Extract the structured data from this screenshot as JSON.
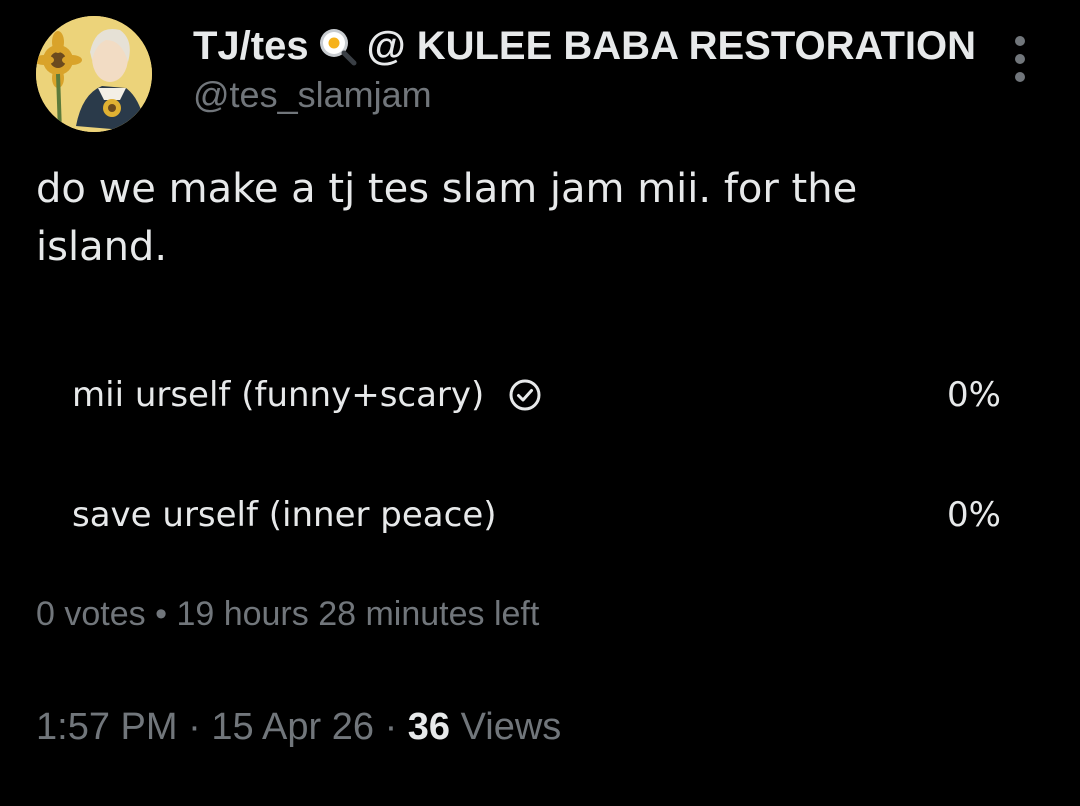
{
  "author": {
    "display_name_before_emoji": "TJ/tes",
    "display_name_emoji": "frying-pan-egg-emoji",
    "display_name_after_emoji": "@ KULEE BABA RESTORATION",
    "handle": "@tes_slamjam",
    "avatar": "profile-avatar-sunflower-illustration"
  },
  "more_menu_icon": "more-vertical-icon",
  "tweet": {
    "text": "do we make a tj tes slam jam mii. for the island."
  },
  "poll": {
    "options": [
      {
        "label": "mii urself (funny+scary)",
        "percent": "0%",
        "fraction": 0,
        "selected": true,
        "selected_icon": "check-circle-icon"
      },
      {
        "label": "save urself (inner peace)",
        "percent": "0%",
        "fraction": 0,
        "selected": false
      }
    ],
    "votes": "0 votes",
    "separator": "•",
    "time_left": "19 hours 28 minutes left"
  },
  "meta": {
    "time": "1:57 PM",
    "dot1": "·",
    "date": "15 Apr 26",
    "dot2": "·",
    "views_count": "36",
    "views_label": "Views"
  },
  "colors": {
    "background": "#000000",
    "primary_text": "#e7e9ea",
    "secondary_text": "#71767b",
    "poll_bar": "#333639"
  }
}
